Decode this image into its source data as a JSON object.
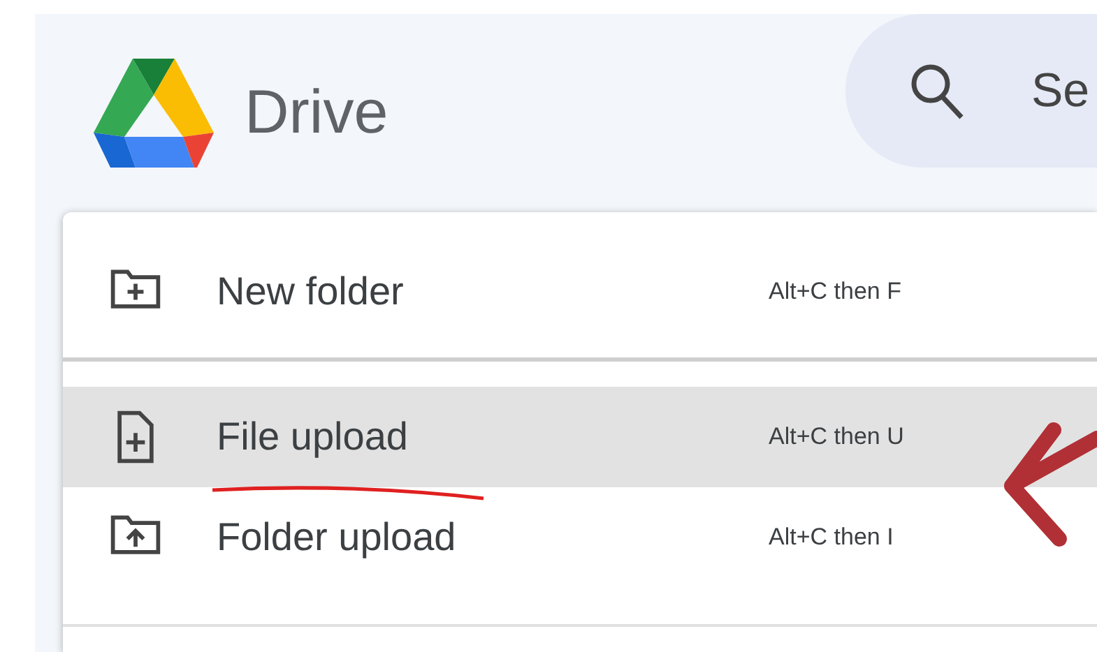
{
  "header": {
    "title": "Drive",
    "search": {
      "placeholder": "Se"
    }
  },
  "menu": {
    "items": [
      {
        "label": "New folder",
        "shortcut": "Alt+C then F",
        "kind": "folder",
        "selected": false
      },
      {
        "label": "File upload",
        "shortcut": "Alt+C then U",
        "kind": "file",
        "selected": true
      },
      {
        "label": "Folder upload",
        "shortcut": "Alt+C then I",
        "kind": "folder-upload",
        "selected": false
      }
    ]
  }
}
